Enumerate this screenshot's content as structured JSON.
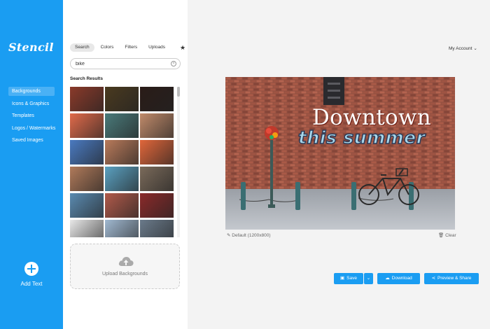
{
  "app": {
    "logo": "Stencil"
  },
  "sidebar": {
    "items": [
      {
        "label": "Backgrounds",
        "active": true
      },
      {
        "label": "Icons & Graphics",
        "active": false
      },
      {
        "label": "Templates",
        "active": false
      },
      {
        "label": "Logos / Watermarks",
        "active": false
      },
      {
        "label": "Saved Images",
        "active": false
      }
    ],
    "add_text_label": "Add Text"
  },
  "panel": {
    "tabs": [
      "Search",
      "Colors",
      "Filters",
      "Uploads"
    ],
    "active_tab": "Search",
    "favorites_glyph": "★",
    "search": {
      "value": "bike",
      "placeholder": ""
    },
    "results_title": "Search Results",
    "upload_label": "Upload Backgrounds",
    "thumbnails": [
      "#8a3a2a",
      "#4a3a20",
      "#2a1c18",
      "#e06a4a",
      "#4a7a7a",
      "#c08a6a",
      "#4a7ac0",
      "#b87a5a",
      "#e0663a",
      "#b07a5a",
      "#5aa0c0",
      "#7a6a5a",
      "#5a8ab0",
      "#b05a4a",
      "#8a2a2a",
      "#e8e8e8",
      "#a0b8d0",
      "#6a7a8a"
    ]
  },
  "header": {
    "account_label": "My Account"
  },
  "canvas": {
    "headline_1": "Downtown",
    "headline_2": "this summer",
    "size_label": "Default (1200x800)",
    "clear_label": "Clear"
  },
  "actions": {
    "save_label": "Save",
    "download_label": "Download",
    "preview_label": "Preview & Share"
  },
  "colors": {
    "brand": "#1a9df2",
    "panel_bg": "#ffffff",
    "workspace_bg": "#f3f3f3"
  }
}
